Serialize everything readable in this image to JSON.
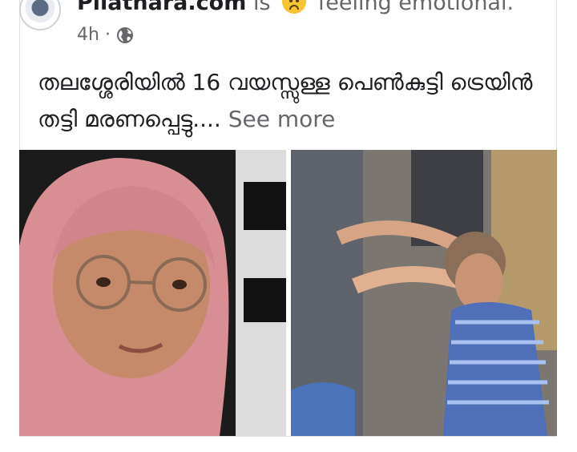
{
  "post": {
    "page_name": "Pilathara.com",
    "is_text": "is",
    "feeling_text": "feeling emotional.",
    "time": "4h",
    "separator": "·",
    "text": "തലശ്ശേരിയിൽ 16 വയസ്സുള്ള പെൺകുട്ടി ട്രെയിൻ തട്ടി മരണപ്പെട്ടു....",
    "see_more": "See more",
    "icons": {
      "feeling": "sad-face-icon",
      "audience": "globe-icon"
    },
    "colors": {
      "text": "#1c1e21",
      "secondary": "#65676b",
      "border": "#dddfe2",
      "emoji": "#f7c531"
    }
  },
  "photos": [
    {
      "name": "photo-girl-hijab-glasses"
    },
    {
      "name": "photo-crying-child-crowd"
    }
  ]
}
